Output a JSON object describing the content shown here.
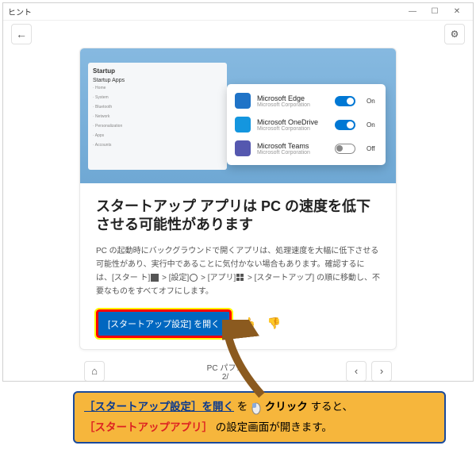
{
  "window": {
    "title": "ヒント"
  },
  "hero": {
    "settings_title": "Startup",
    "settings_sub": "Startup Apps",
    "apps": [
      {
        "name": "Microsoft Edge",
        "sub": "Microsoft Corporation",
        "state": "On",
        "on": true,
        "color": "#1f73c7"
      },
      {
        "name": "Microsoft OneDrive",
        "sub": "Microsoft Corporation",
        "state": "On",
        "on": true,
        "color": "#1496df"
      },
      {
        "name": "Microsoft Teams",
        "sub": "Microsoft Corporation",
        "state": "Off",
        "on": false,
        "color": "#5558af"
      }
    ],
    "nav_items": [
      "Home",
      "System",
      "Bluetooth",
      "Network",
      "Personalization",
      "Apps",
      "Accounts"
    ]
  },
  "tip": {
    "title": "スタートアップ アプリは PC の速度を低下させる可能性があります",
    "desc_before": "PC の起動時にバックグラウンドで開くアプリは、処理速度を大幅に低下させる可能性があり、実行中であることに気付かない場合もあります。確認するには、[スター\nト]",
    "seg_settings": " > [設定]",
    "seg_apps": " > [アプリ]",
    "seg_startup": " > [スタートアップ]",
    "desc_after": " の順に移動し、不要なものをすべてオフにします。",
    "button": "[スタートアップ設定] を開く"
  },
  "pager": {
    "category": "PC パフォ",
    "page": "2/"
  },
  "callout": {
    "line1_bold": "［スタートアップ設定］を開く",
    "line1_mid": " を ",
    "line1_click": "クリック",
    "line1_after": "すると、",
    "line2_red": "［スタートアップアプリ］",
    "line2_after": " の設定画面が開きます。"
  }
}
